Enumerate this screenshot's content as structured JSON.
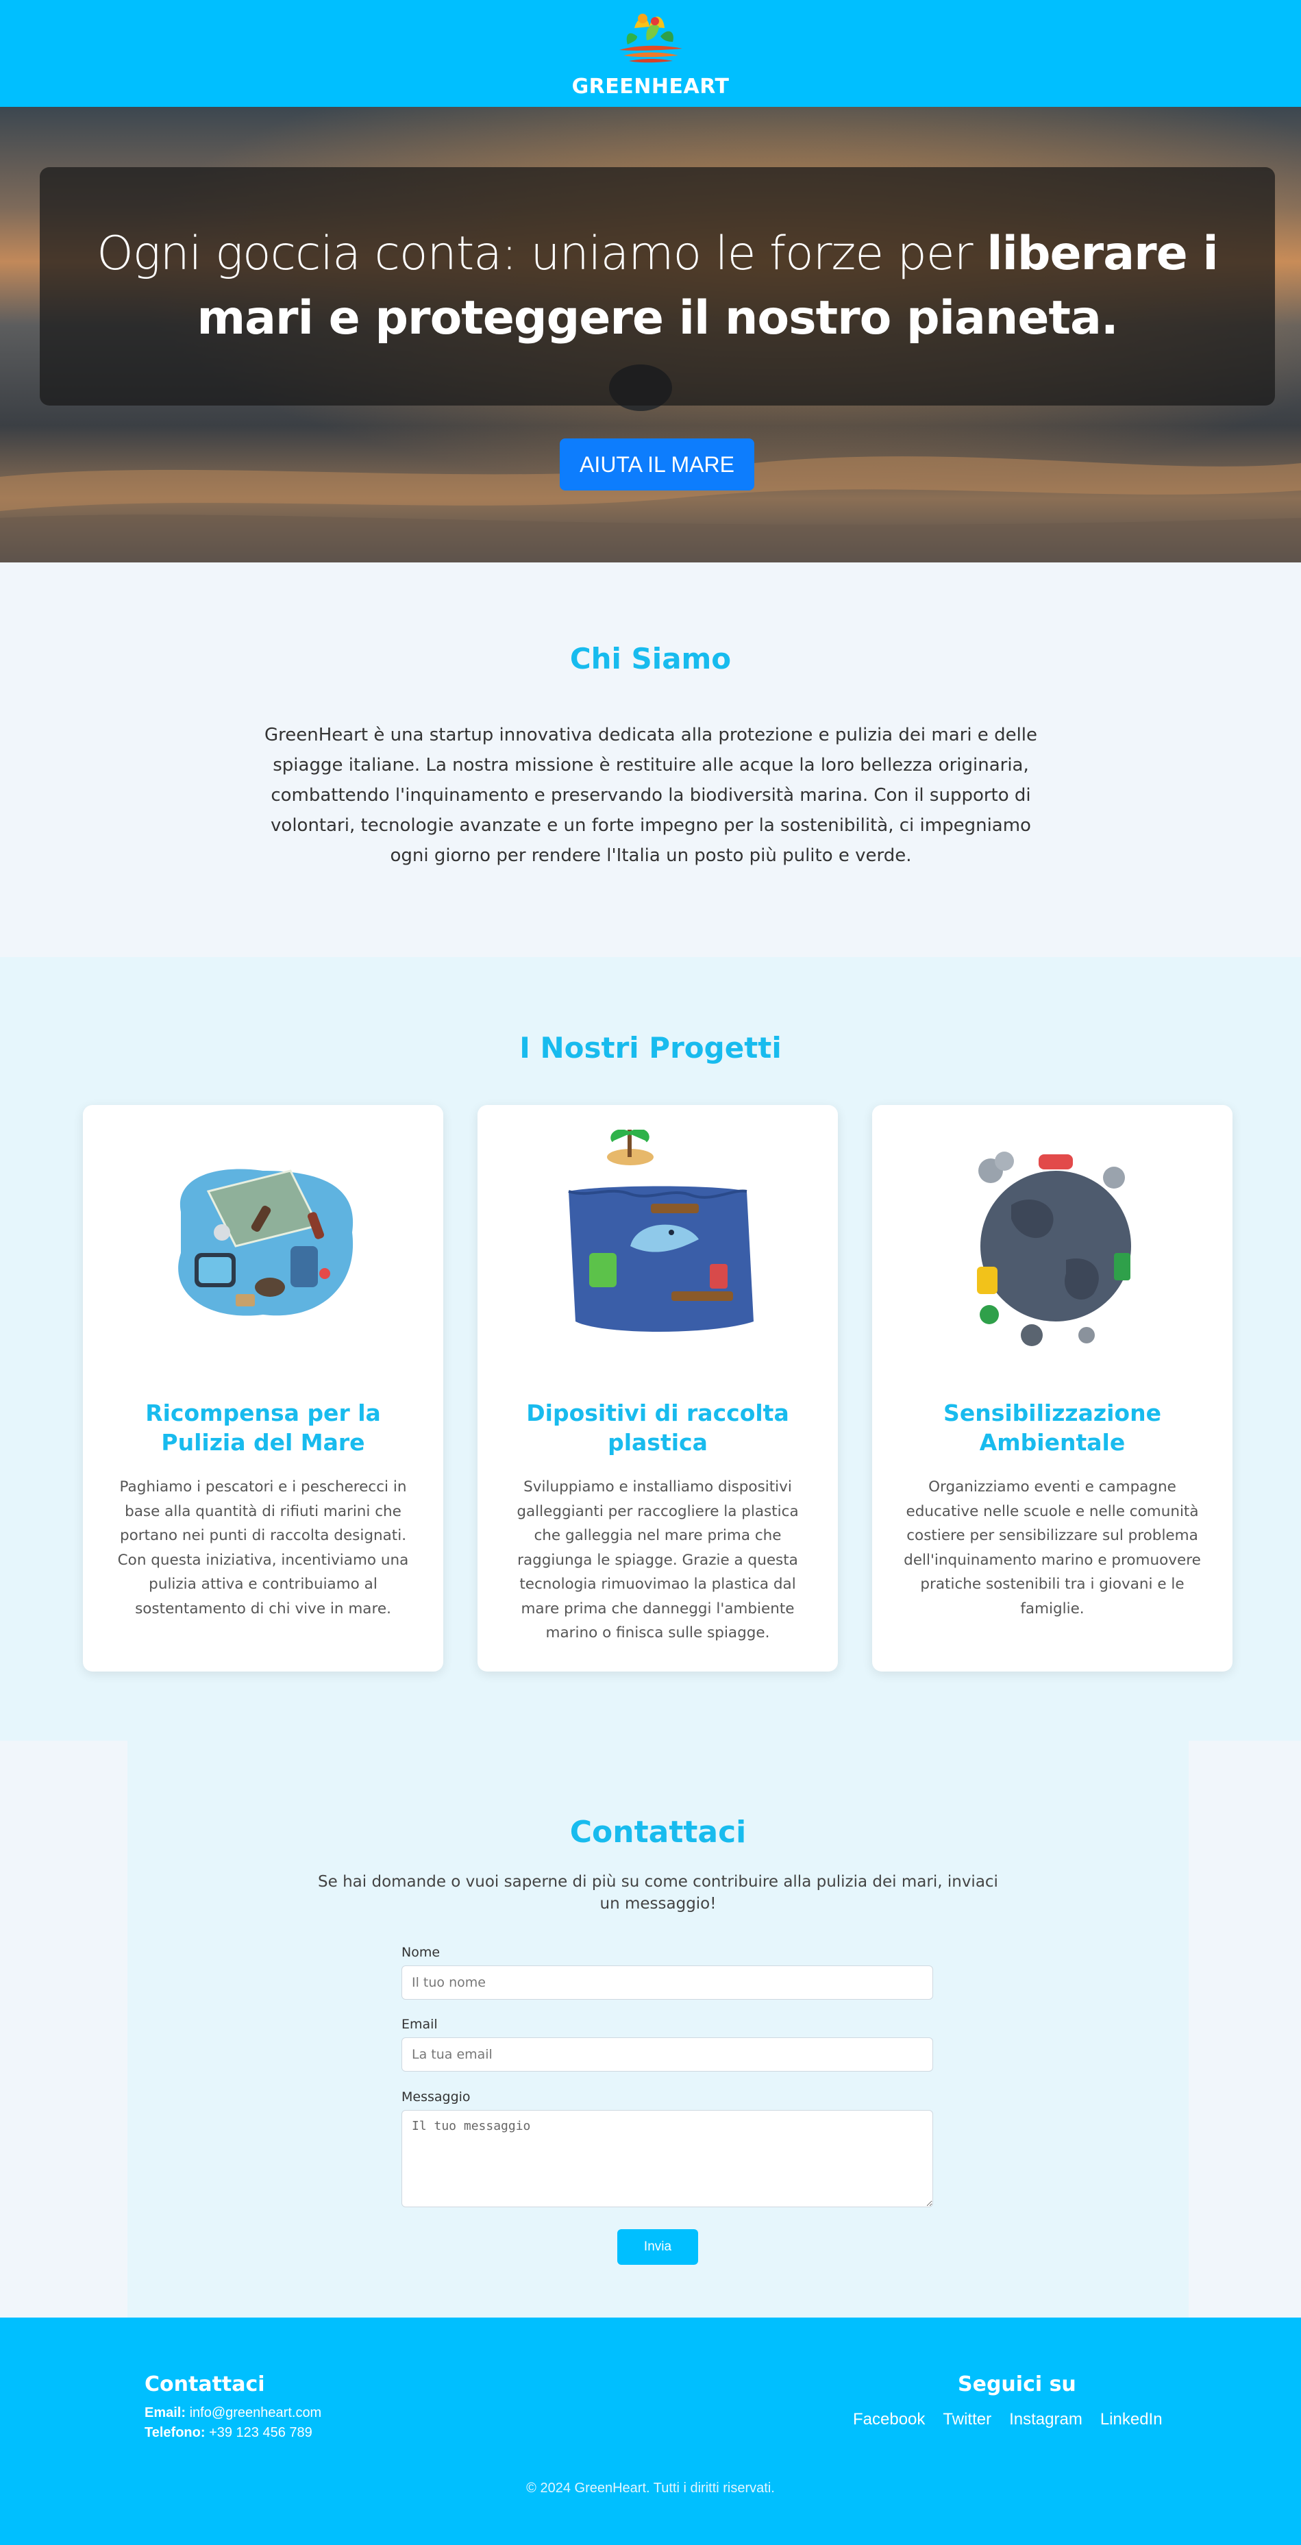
{
  "header": {
    "brand": "GREENHEART",
    "logo_icon": "greenheart-logo",
    "background": "#00bfff"
  },
  "hero": {
    "title_regular": "Ogni goccia conta: uniamo le forze per ",
    "title_bold": "liberare i mari e proteggere il nostro pianeta.",
    "cta_label": "AIUTA IL MARE",
    "cta_color": "#0d7dfd"
  },
  "about": {
    "title": "Chi Siamo",
    "text": "GreenHeart è una startup innovativa dedicata alla protezione e pulizia dei mari e delle spiagge italiane. La nostra missione è restituire alle acque la loro bellezza originaria, combattendo l'inquinamento e preservando la biodiversità marina. Con il supporto di volontari, tecnologie avanzate e un forte impegno per la sostenibilità, ci impegniamo ogni giorno per rendere l'Italia un posto più pulito e verde."
  },
  "projects": {
    "title": "I Nostri Progetti",
    "items": [
      {
        "title": "Ricompensa per la Pulizia del Mare",
        "text": "Paghiamo i pescatori e i pescherecci in base alla quantità di rifiuti marini che portano nei punti di raccolta designati. Con questa iniziativa, incentiviamo una pulizia attiva e contribuiamo al sostentamento di chi vive in mare.",
        "icon": "sea-trash-illustration"
      },
      {
        "title": "Dipositivi di raccolta plastica",
        "text": "Sviluppiamo e installiamo dispositivi galleggianti per raccogliere la plastica che galleggia nel mare prima che raggiunga le spiagge. Grazie a questa tecnologia rimuovimao la plastica dal mare prima che danneggi l'ambiente marino o finisca sulle spiagge.",
        "icon": "polluted-ocean-dolphin-illustration"
      },
      {
        "title": "Sensibilizzazione Ambientale",
        "text": "Organizziamo eventi e campagne educative nelle scuole e nelle comunità costiere per sensibilizzare sul problema dell'inquinamento marino e promuovere pratiche sostenibili tra i giovani e le famiglie.",
        "icon": "polluted-earth-illustration"
      }
    ]
  },
  "contact": {
    "title": "Contattaci",
    "intro": "Se hai domande o vuoi saperne di più su come contribuire alla pulizia dei mari, inviaci un messaggio!",
    "name_label": "Nome",
    "name_placeholder": "Il tuo nome",
    "email_label": "Email",
    "email_placeholder": "La tua email",
    "message_label": "Messaggio",
    "message_placeholder": "Il tuo messaggio",
    "submit_label": "Invia"
  },
  "footer": {
    "contact_title": "Contattaci",
    "email_label": "Email:",
    "email_value": "info@greenheart.com",
    "phone_label": "Telefono:",
    "phone_value": "+39 123 456 789",
    "social_title": "Seguici su",
    "links": [
      "Facebook",
      "Twitter",
      "Instagram",
      "LinkedIn"
    ],
    "copyright": "© 2024 GreenHeart. Tutti i diritti riservati."
  },
  "colors": {
    "brand_blue": "#00bfff",
    "heading_blue": "#18bbee",
    "cta_blue": "#0d7dfd",
    "section_light": "#e6f6fc",
    "page_bg": "#f1f6fb"
  }
}
